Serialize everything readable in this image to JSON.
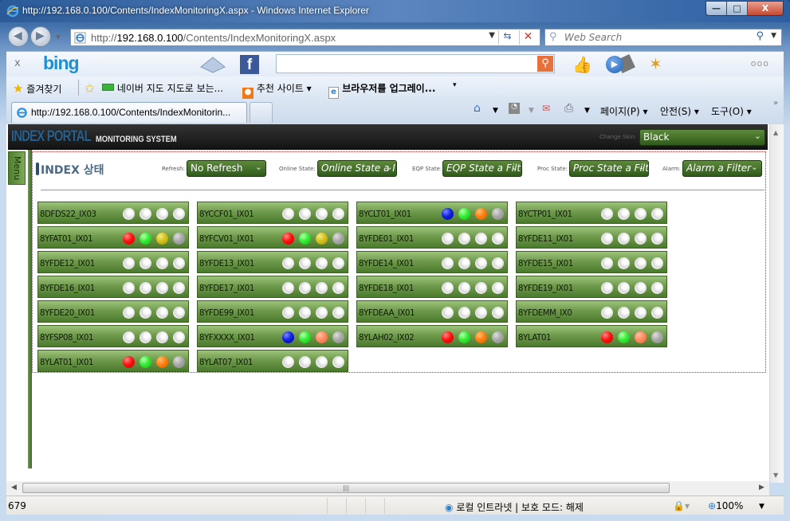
{
  "window": {
    "title": "http://192.168.0.100/Contents/IndexMonitoringX.aspx - Windows Internet Explorer",
    "minimize": "—",
    "maximize": "□",
    "close": "X"
  },
  "nav": {
    "back_icon": "◀",
    "forward_icon": "▶",
    "address_prefix": "http://",
    "address_host": "192.168.0.100",
    "address_path": "/Contents/IndexMonitoringX.aspx",
    "search_placeholder": "Web Search"
  },
  "bing_bar": {
    "close": "x",
    "logo": "bing",
    "more": "ooo"
  },
  "favorites": {
    "favorites_label": "즐겨찾기",
    "items": [
      {
        "label": "네이버 지도  지도로 보는..."
      },
      {
        "label": "추천 사이트 ▾"
      },
      {
        "label": "브라우저를 업그레이..."
      }
    ],
    "more": "▾"
  },
  "tabs": [
    {
      "label": "http://192.168.0.100/Contents/IndexMonitorin..."
    }
  ],
  "command_bar": {
    "page": "페이지(P) ▾",
    "safety": "안전(S) ▾",
    "tools": "도구(O) ▾",
    "overflow": "»"
  },
  "portal": {
    "logo_main": "INDEX PORTAL",
    "logo_sub": "MONITORING SYSTEM",
    "skin_label": "Change Skin:",
    "skin_value": "Black",
    "menu_tab": "Menu",
    "panel_title": "INDEX 상태",
    "filters": {
      "refresh_label": "Refresh:",
      "refresh_value": "No Refresh",
      "online_label": "Online State:",
      "online_value": "Online State a I",
      "eqp_label": "EQP State:",
      "eqp_value": "EQP State a Filt",
      "proc_label": "Proc State:",
      "proc_value": "Proc State a Filt",
      "alarm_label": "Alarm:",
      "alarm_value": "Alarm a Filter"
    },
    "status_colors": {
      "white": "#ffffff",
      "red": "#ff1010",
      "green": "#33ee33",
      "yellow": "#d4c21a",
      "gray": "#a8a8a8",
      "blue": "#1020e0",
      "orange": "#ff8010",
      "salmon": "#ff8a60"
    },
    "cards": [
      {
        "name": "8DFDS22_IX03",
        "lights": [
          "white",
          "white",
          "white",
          "white"
        ]
      },
      {
        "name": "8YCCF01_IX01",
        "lights": [
          "white",
          "white",
          "white",
          "white"
        ]
      },
      {
        "name": "8YCLT01_IX01",
        "lights": [
          "blue",
          "green",
          "orange",
          "gray"
        ]
      },
      {
        "name": "8YCTP01_IX01",
        "lights": [
          "white",
          "white",
          "white",
          "white"
        ]
      },
      {
        "name": "8YFAT01_IX01",
        "lights": [
          "red",
          "green",
          "yellow",
          "gray"
        ]
      },
      {
        "name": "8YFCV01_IX01",
        "lights": [
          "red",
          "green",
          "yellow",
          "gray"
        ]
      },
      {
        "name": "8YFDE01_IX01",
        "lights": [
          "white",
          "white",
          "white",
          "white"
        ]
      },
      {
        "name": "8YFDE11_IX01",
        "lights": [
          "white",
          "white",
          "white",
          "white"
        ]
      },
      {
        "name": "8YFDE12_IX01",
        "lights": [
          "white",
          "white",
          "white",
          "white"
        ]
      },
      {
        "name": "8YFDE13_IX01",
        "lights": [
          "white",
          "white",
          "white",
          "white"
        ]
      },
      {
        "name": "8YFDE14_IX01",
        "lights": [
          "white",
          "white",
          "white",
          "white"
        ]
      },
      {
        "name": "8YFDE15_IX01",
        "lights": [
          "white",
          "white",
          "white",
          "white"
        ]
      },
      {
        "name": "8YFDE16_IX01",
        "lights": [
          "white",
          "white",
          "white",
          "white"
        ]
      },
      {
        "name": "8YFDE17_IX01",
        "lights": [
          "white",
          "white",
          "white",
          "white"
        ]
      },
      {
        "name": "8YFDE18_IX01",
        "lights": [
          "white",
          "white",
          "white",
          "white"
        ]
      },
      {
        "name": "8YFDE19_IX01",
        "lights": [
          "white",
          "white",
          "white",
          "white"
        ]
      },
      {
        "name": "8YFDE20_IX01",
        "lights": [
          "white",
          "white",
          "white",
          "white"
        ]
      },
      {
        "name": "8YFDE99_IX01",
        "lights": [
          "white",
          "white",
          "white",
          "white"
        ]
      },
      {
        "name": "8YFDEAA_IX01",
        "lights": [
          "white",
          "white",
          "white",
          "white"
        ]
      },
      {
        "name": "8YFDEMM_IX0",
        "lights": [
          "white",
          "white",
          "white",
          "white"
        ]
      },
      {
        "name": "8YFSP08_IX01",
        "lights": [
          "white",
          "white",
          "white",
          "white"
        ]
      },
      {
        "name": "8YFXXXX_IX01",
        "lights": [
          "blue",
          "green",
          "salmon",
          "gray"
        ]
      },
      {
        "name": "8YLAH02_IX02",
        "lights": [
          "red",
          "green",
          "orange",
          "gray"
        ]
      },
      {
        "name": "8YLAT01",
        "lights": [
          "red",
          "green",
          "salmon",
          "gray"
        ]
      },
      {
        "name": "8YLAT01_IX01",
        "lights": [
          "red",
          "green",
          "orange",
          "gray"
        ]
      },
      {
        "name": "8YLAT07_IX01",
        "lights": [
          "white",
          "white",
          "white",
          "white"
        ]
      }
    ]
  },
  "statusbar": {
    "left": "679",
    "zone": "로컬 인트라넷 | 보호 모드: 해제",
    "zoom": "100%"
  }
}
